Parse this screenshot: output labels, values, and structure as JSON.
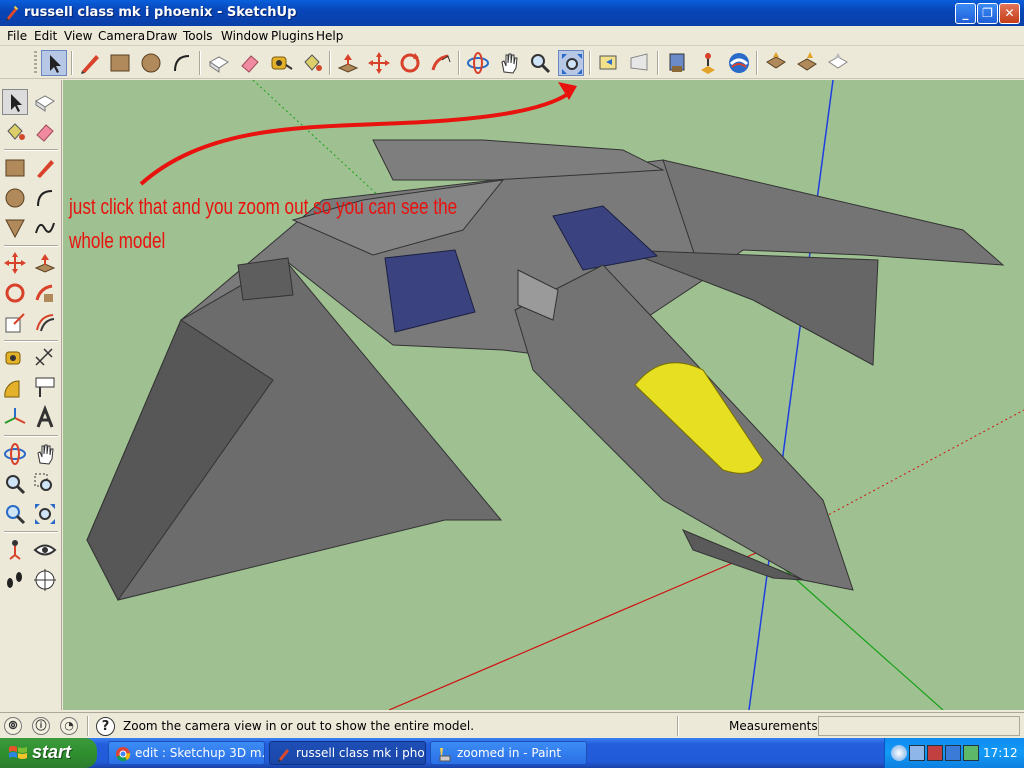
{
  "window": {
    "title": "russell class mk i phoenix - SketchUp",
    "minimize_label": "_",
    "maximize_label": "❐",
    "close_label": "✕"
  },
  "menu": [
    "File",
    "Edit",
    "View",
    "Camera",
    "Draw",
    "Tools",
    "Window",
    "Plugins",
    "Help"
  ],
  "toolbar": {
    "icons": [
      "select-icon",
      "pencil-icon",
      "rectangle-icon",
      "circle-icon",
      "arc-icon",
      "make-component-icon",
      "eraser-icon",
      "tape-measure-icon",
      "paint-bucket-icon",
      "push-pull-icon",
      "move-icon",
      "rotate-icon",
      "follow-me-icon",
      "orbit-icon",
      "pan-icon",
      "zoom-icon",
      "zoom-extents-icon",
      "previous-view-icon",
      "next-view-icon",
      "google-earth-snapshot-icon",
      "place-model-icon",
      "get-current-view-icon",
      "3d-warehouse-icon",
      "get-models-icon",
      "share-model-icon",
      "share-component-icon"
    ],
    "active": "zoom-extents-icon"
  },
  "annotation": {
    "line1": "just click that and you zoom out so you can see the",
    "line2": "whole model"
  },
  "status": {
    "text": "Zoom the camera view in or out to show the entire model.",
    "measurements_label": "Measurements",
    "measurements_value": "",
    "help_glyph": "?"
  },
  "taskbar": {
    "start_label": "start",
    "tasks": [
      {
        "label": "edit : Sketchup 3D m...",
        "icon": "chrome-icon"
      },
      {
        "label": "russell class mk i phoe...",
        "icon": "sketchup-icon"
      },
      {
        "label": "zoomed in - Paint",
        "icon": "paint-icon"
      }
    ],
    "clock": "17:12"
  },
  "colors": {
    "viewport_bg": "#9fc192",
    "annotation": "#e8120e",
    "canopy": "#e7df22"
  }
}
